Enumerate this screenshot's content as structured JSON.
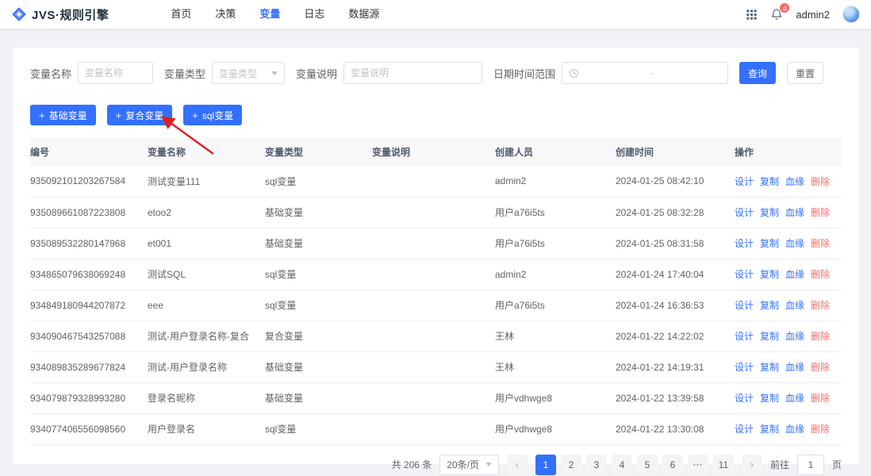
{
  "header": {
    "logo_text": "JVS·规则引擎",
    "nav": [
      {
        "label": "首页",
        "active": false
      },
      {
        "label": "决策",
        "active": false
      },
      {
        "label": "变量",
        "active": true
      },
      {
        "label": "日志",
        "active": false
      },
      {
        "label": "数据源",
        "active": false
      }
    ],
    "notification_count": "4",
    "username": "admin2"
  },
  "filters": {
    "name_label": "变量名称",
    "name_placeholder": "变量名称",
    "type_label": "变量类型",
    "type_placeholder": "变量类型",
    "desc_label": "变量说明",
    "desc_placeholder": "变量说明",
    "date_label": "日期时间范围",
    "date_separator": "-",
    "search_button": "查询",
    "reset_button": "重置"
  },
  "actions": [
    {
      "icon": "+",
      "label": "基础变量"
    },
    {
      "icon": "+",
      "label": "复合变量"
    },
    {
      "icon": "+",
      "label": "sql变量"
    }
  ],
  "table": {
    "columns": [
      "编号",
      "变量名称",
      "变量类型",
      "变量说明",
      "创建人员",
      "创建时间",
      "操作"
    ],
    "op_labels": [
      "设计",
      "复制",
      "血缘",
      "删除"
    ],
    "rows": [
      {
        "id": "935092101203267584",
        "name": "测试变量111",
        "type": "sql变量",
        "desc": "",
        "creator": "admin2",
        "created": "2024-01-25 08:42:10"
      },
      {
        "id": "935089661087223808",
        "name": "etoo2",
        "type": "基础变量",
        "desc": "",
        "creator": "用户a76i5ts",
        "created": "2024-01-25 08:32:28"
      },
      {
        "id": "935089532280147968",
        "name": "et001",
        "type": "基础变量",
        "desc": "",
        "creator": "用户a76i5ts",
        "created": "2024-01-25 08:31:58"
      },
      {
        "id": "934865079638069248",
        "name": "测试SQL",
        "type": "sql变量",
        "desc": "",
        "creator": "admin2",
        "created": "2024-01-24 17:40:04"
      },
      {
        "id": "934849180944207872",
        "name": "eee",
        "type": "sql变量",
        "desc": "",
        "creator": "用户a76i5ts",
        "created": "2024-01-24 16:36:53"
      },
      {
        "id": "934090467543257088",
        "name": "测试-用户登录名称-复合",
        "type": "复合变量",
        "desc": "",
        "creator": "王林",
        "created": "2024-01-22 14:22:02"
      },
      {
        "id": "934089835289677824",
        "name": "测试-用户登录名称",
        "type": "基础变量",
        "desc": "",
        "creator": "王林",
        "created": "2024-01-22 14:19:31"
      },
      {
        "id": "934079879328993280",
        "name": "登录名昵称",
        "type": "基础变量",
        "desc": "",
        "creator": "用户vdhwge8",
        "created": "2024-01-22 13:39:58"
      },
      {
        "id": "934077406556098560",
        "name": "用户登录名",
        "type": "sql变量",
        "desc": "",
        "creator": "用户vdhwge8",
        "created": "2024-01-22 13:30:08"
      }
    ]
  },
  "pagination": {
    "total_text": "共 206 条",
    "page_size": "20条/页",
    "prev_icon": "‹",
    "next_icon": "›",
    "pages": [
      "1",
      "2",
      "3",
      "4",
      "5",
      "6",
      "•••",
      "11"
    ],
    "active_page": "1",
    "goto_label": "前往",
    "goto_value": "1",
    "goto_suffix": "页"
  }
}
